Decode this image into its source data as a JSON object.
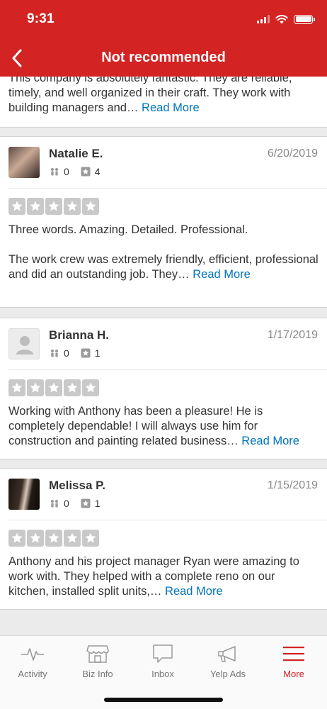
{
  "status": {
    "time": "9:31"
  },
  "header": {
    "title": "Not recommended"
  },
  "first_review": {
    "text": "This company is absolutely fantastic. They are reliable, timely, and well organized in their craft. They work with building managers and…",
    "read_more": "Read More"
  },
  "reviews": [
    {
      "name": "Natalie E.",
      "date": "6/20/2019",
      "friends": "0",
      "reviews_count": "4",
      "rating": 0,
      "text_line1": "Three words. Amazing. Detailed. Professional.",
      "text_line2": "The work crew was extremely friendly, efficient, professional and did an outstanding job. They…",
      "read_more": "Read More"
    },
    {
      "name": "Brianna H.",
      "date": "1/17/2019",
      "friends": "0",
      "reviews_count": "1",
      "rating": 0,
      "text": "Working with Anthony has been a pleasure! He is completely dependable! I will always use him for construction and painting related business…",
      "read_more": "Read More"
    },
    {
      "name": "Melissa P.",
      "date": "1/15/2019",
      "friends": "0",
      "reviews_count": "1",
      "rating": 0,
      "text": "Anthony and his project manager Ryan were amazing to work with. They helped with a complete reno on our kitchen, installed split units,…",
      "read_more": "Read More"
    }
  ],
  "tabs": [
    {
      "label": "Activity",
      "icon": "activity-icon"
    },
    {
      "label": "Biz Info",
      "icon": "storefront-icon"
    },
    {
      "label": "Inbox",
      "icon": "chat-bubble-icon"
    },
    {
      "label": "Yelp Ads",
      "icon": "megaphone-icon"
    },
    {
      "label": "More",
      "icon": "hamburger-menu-icon",
      "active": true
    }
  ],
  "colors": {
    "brand_red": "#d32323",
    "link_blue": "#0073bb",
    "star_empty": "#c9c9ca"
  }
}
